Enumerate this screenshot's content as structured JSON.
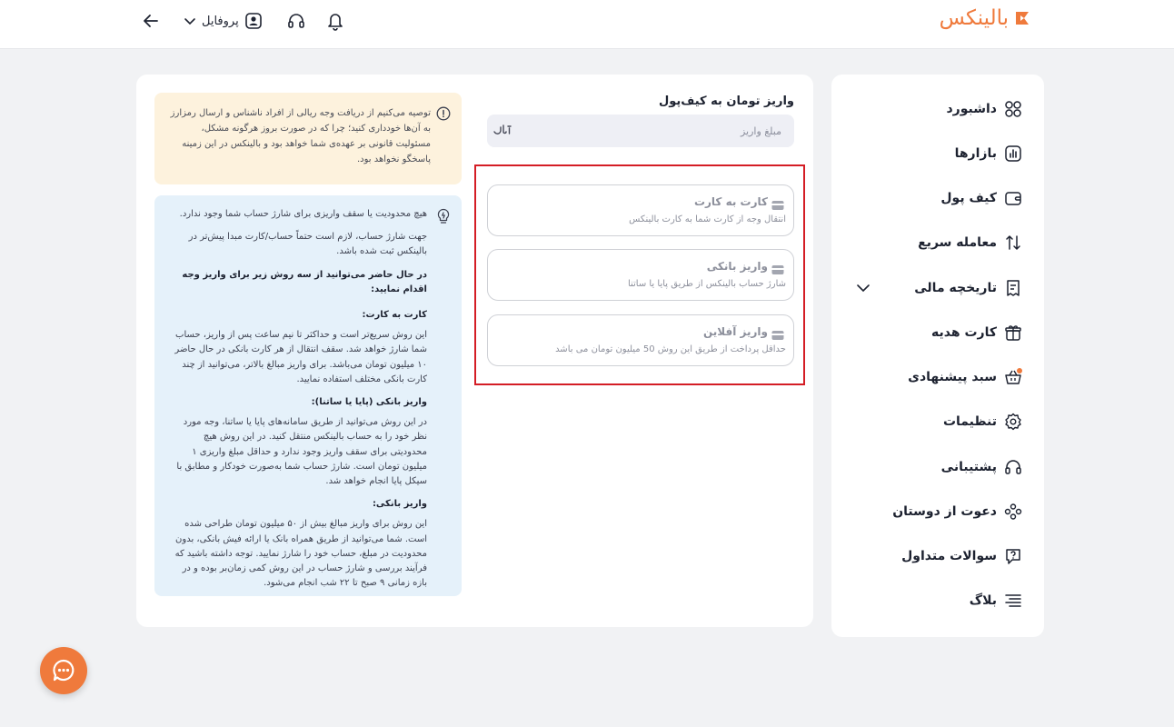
{
  "header": {
    "logo_text": "بالینکس",
    "profile_label": "پروفایل"
  },
  "sidebar": {
    "items": [
      {
        "label": "داشبورد",
        "icon": "dashboard-grid-icon"
      },
      {
        "label": "بازارها",
        "icon": "market-chart-icon"
      },
      {
        "label": "کیف پول",
        "icon": "wallet-icon"
      },
      {
        "label": "معامله سریع",
        "icon": "swap-arrows-icon"
      },
      {
        "label": "تاریخچه مالی",
        "icon": "receipt-icon"
      },
      {
        "label": "کارت هدیه",
        "icon": "gift-icon"
      },
      {
        "label": "سبد پیشنهادی",
        "icon": "basket-icon"
      },
      {
        "label": "تنظیمات",
        "icon": "gear-icon"
      },
      {
        "label": "پشتیبانی",
        "icon": "headset-icon"
      },
      {
        "label": "دعوت از دوستان",
        "icon": "people-icon"
      },
      {
        "label": "سوالات متداول",
        "icon": "question-icon"
      },
      {
        "label": "بلاگ",
        "icon": "text-lines-icon"
      }
    ]
  },
  "deposit": {
    "title": "واریز تومان به کیف‌پول",
    "amount_placeholder": "مبلغ واریز",
    "methods": [
      {
        "title": "کارت به کارت",
        "desc": "انتقال وجه از کارت شما به کارت بالینکس"
      },
      {
        "title": "واریز بانکی",
        "desc": "شارژ حساب بالینکس از طریق پایا یا ساتنا"
      },
      {
        "title": "واریز آفلاین",
        "desc": "حداقل پرداخت از طریق این روش 50 میلیون تومان می باشد"
      }
    ]
  },
  "warning": {
    "text": "توصیه می‌کنیم از دریافت وجه ریالی از افراد ناشناس و ارسال رمزارز به آن‌ها خودداری کنید؛ چرا که در صورت بروز هرگونه مشکل، مسئولیت قانونی بر عهده‌ی شما خواهد بود و بالینکس در این زمینه پاسخگو نخواهد بود."
  },
  "info": {
    "p1": "هیچ محدودیت یا سقف واریزی برای شارژ حساب شما وجود ندارد.",
    "p2": "جهت شارژ حساب، لازم است حتماً حساب/کارت مبدا پیش‌تر در بالینکس ثبت شده باشد.",
    "h1": "در حال حاضر می‌توانید از سه روش زیر برای واریز وجه اقدام نمایید:",
    "h2": "کارت به کارت:",
    "p3": "این روش سریع‌تر است و حداکثر تا نیم ساعت پس از واریز، حساب شما شارژ خواهد شد. سقف انتقال از هر کارت بانکی در حال حاضر ۱۰ میلیون تومان می‌باشد. برای واریز مبالغ بالاتر، می‌توانید از چند کارت بانکی مختلف استفاده نمایید.",
    "h3": "واریز بانکی (پایا یا ساتنا):",
    "p4": "در این روش می‌توانید از طریق سامانه‌های پایا یا ساتنا، وجه مورد نظر خود را به حساب بالینکس منتقل کنید. در این روش هیچ محدودیتی برای سقف واریز وجود ندارد و حداقل مبلغ واریزی ۱ میلیون تومان است. شارژ حساب شما به‌صورت خودکار و مطابق با سیکل پایا انجام خواهد شد.",
    "h4": "واریز بانکی:",
    "p5": "این روش برای واریز مبالغ بیش از ۵۰ میلیون تومان طراحی شده است. شما می‌توانید از طریق همراه بانک یا ارائه فیش بانکی، بدون محدودیت در مبلغ، حساب خود را شارژ نمایید. توجه داشته باشید که فرآیند بررسی و شارژ حساب در این روش کمی زمان‌بر بوده و در بازه زمانی ۹ صبح تا ۲۲ شب انجام می‌شود."
  },
  "colors": {
    "brand": "#ef7a3c",
    "highlight": "#d41d25",
    "warning_bg": "#fdf2dd",
    "info_bg": "#e5f1fa"
  }
}
